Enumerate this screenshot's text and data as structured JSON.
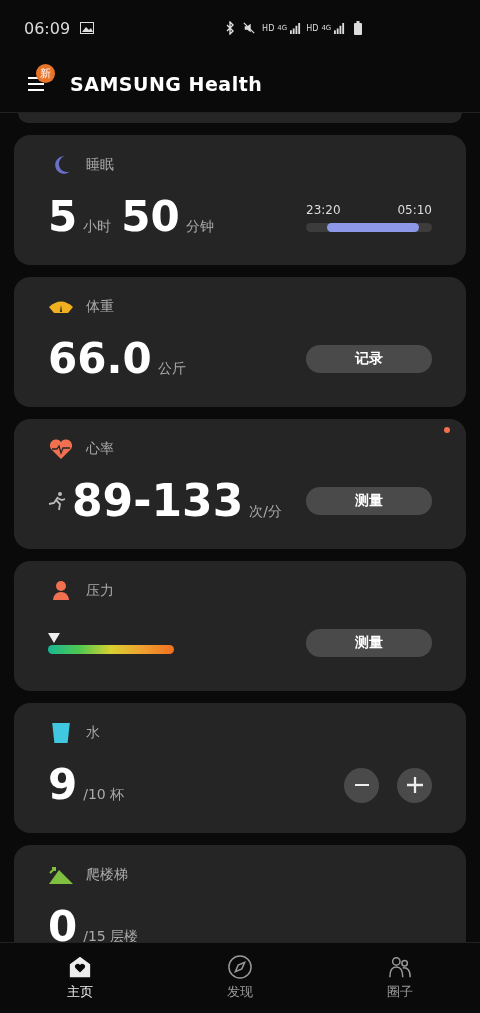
{
  "status_bar": {
    "time": "06:09",
    "networks": [
      {
        "hd": "HD",
        "gen": "4G"
      },
      {
        "hd": "HD",
        "gen": "4G"
      }
    ]
  },
  "header": {
    "title": "SAMSUNG Health",
    "badge": "新"
  },
  "cards": [
    {
      "kind": "sleep",
      "title": "睡眠",
      "hours": "5",
      "hours_unit": "小时",
      "minutes": "50",
      "minutes_unit": "分钟",
      "start": "23:20",
      "end": "05:10"
    },
    {
      "kind": "weight",
      "title": "体重",
      "value": "66.0",
      "unit": "公斤",
      "button": "记录"
    },
    {
      "kind": "heart",
      "title": "心率",
      "value": "89-133",
      "unit": "次/分",
      "button": "测量",
      "new": true
    },
    {
      "kind": "stress",
      "title": "压力",
      "level": 0,
      "button": "测量"
    },
    {
      "kind": "water",
      "title": "水",
      "value": "9",
      "unit": "/10 杯"
    },
    {
      "kind": "stairs",
      "title": "爬楼梯",
      "value": "0",
      "unit": "/15 层楼"
    }
  ],
  "nav": [
    {
      "label": "主页",
      "selected": true
    },
    {
      "label": "发现",
      "selected": false
    },
    {
      "label": "圈子",
      "selected": false
    }
  ]
}
